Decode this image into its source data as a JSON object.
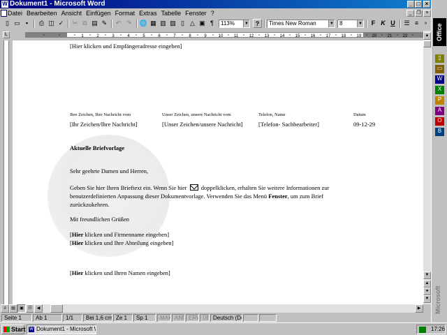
{
  "window": {
    "title": "Dokument1 - Microsoft Word"
  },
  "menu": [
    "Datei",
    "Bearbeiten",
    "Ansicht",
    "Einfügen",
    "Format",
    "Extras",
    "Tabelle",
    "Fenster",
    "?"
  ],
  "toolbar": {
    "zoom": "113%",
    "font": "Times New Roman",
    "size": "8",
    "bold": "F",
    "italic": "K",
    "underline": "U",
    "help": "?"
  },
  "document": {
    "recipient": "[Hier klicken und Empfängeradresse eingeben]",
    "ref_headers": [
      "Ihre Zeichen, Ihre Nachricht vom",
      "Unser Zeichen, unsere Nachricht vom",
      "Telefon, Name",
      "Datum"
    ],
    "ref_values": [
      "[Ihr Zeichen/Ihre Nachricht]",
      "[Unser Zeichen/unsere Nachricht]",
      "[Telefon- Sachbearbeiter]",
      "09-12-29"
    ],
    "subject": "Aktuelle Briefvorlage",
    "salutation": "Sehr geehrte Damen und Herren,",
    "body_line1_a": "Geben Sie hier Ihren Brieftext ein. Wenn Sie hier",
    "body_line1_b": "doppelklicken, erhalten Sie weitere Informationen zur",
    "body_line2_a": "benutzerdefinierten Anpassung dieser Dokumentvorlage. Verwenden Sie das Menü",
    "body_line2_bold": "Fenster",
    "body_line2_b": ", um zum Brief",
    "body_line3": "zurückzukehren.",
    "closing": "Mit freundlichen Grüßen",
    "company": {
      "open": "[",
      "bold": "Hier",
      "rest": " klicken und Firmenname eingeben]"
    },
    "department": {
      "open": "[",
      "bold": "Hier",
      "rest": " klicken und Ihre Abteilung eingeben]"
    },
    "name": {
      "open": "[",
      "bold": "Hier",
      "rest": " klicken und Ihren Namen eingeben]"
    }
  },
  "ruler_numbers": [
    "1",
    "2",
    "3",
    "4",
    "5",
    "6",
    "7",
    "8",
    "9",
    "10",
    "11",
    "12",
    "13",
    "14",
    "15",
    "16",
    "17",
    "18",
    "19",
    "20",
    "21",
    "22"
  ],
  "status": {
    "page": "Seite 1",
    "section": "Ab 1",
    "pages": "1/1",
    "position": "Bei 1,6 cm",
    "line": "Ze 1",
    "column": "Sp 1",
    "mak": "MAK",
    "and": "AND",
    "erw": "ERW",
    "ue": "ÜB",
    "language": "Deutsch (De"
  },
  "officebar": {
    "label": "Office",
    "vendor": "Microsoft"
  },
  "taskbar": {
    "start": "Start",
    "task": "Dokument1 - Microsoft Word",
    "clock": "17:26"
  }
}
